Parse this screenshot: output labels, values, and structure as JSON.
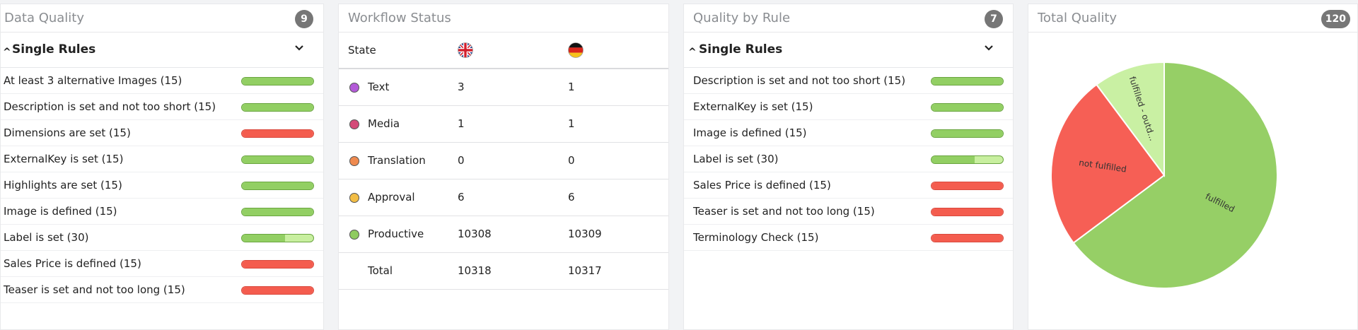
{
  "data_quality": {
    "title": "Data Quality",
    "count": "9",
    "group_title": "Single Rules",
    "rules": [
      {
        "label": "At least 3 alternative Images (15)",
        "fulfilled": 1.0,
        "status": "green"
      },
      {
        "label": "Description is set and not too short (15)",
        "fulfilled": 1.0,
        "status": "green"
      },
      {
        "label": "Dimensions are set (15)",
        "fulfilled": 0.0,
        "status": "red"
      },
      {
        "label": "ExternalKey is set (15)",
        "fulfilled": 1.0,
        "status": "green"
      },
      {
        "label": "Highlights are set (15)",
        "fulfilled": 1.0,
        "status": "green"
      },
      {
        "label": "Image is defined (15)",
        "fulfilled": 1.0,
        "status": "green"
      },
      {
        "label": "Label is set (30)",
        "fulfilled": 0.6,
        "status": "green"
      },
      {
        "label": "Sales Price is defined (15)",
        "fulfilled": 0.0,
        "status": "red"
      },
      {
        "label": "Teaser is set and not too long (15)",
        "fulfilled": 0.0,
        "status": "red"
      }
    ]
  },
  "workflow_status": {
    "title": "Workflow Status",
    "header": {
      "state": "State",
      "col_en_icon": "uk-flag-icon",
      "col_de_icon": "germany-flag-icon"
    },
    "rows": [
      {
        "state": "Text",
        "en": "3",
        "de": "1",
        "color": "#b35ad8"
      },
      {
        "state": "Media",
        "en": "1",
        "de": "1",
        "color": "#d44a78"
      },
      {
        "state": "Translation",
        "en": "0",
        "de": "0",
        "color": "#ef8a4f"
      },
      {
        "state": "Approval",
        "en": "6",
        "de": "6",
        "color": "#f2bd45"
      },
      {
        "state": "Productive",
        "en": "10308",
        "de": "10309",
        "color": "#8fcb60"
      }
    ],
    "total": {
      "state": "Total",
      "en": "10318",
      "de": "10317"
    }
  },
  "quality_by_rule": {
    "title": "Quality by Rule",
    "count": "7",
    "group_title": "Single Rules",
    "rules": [
      {
        "label": "Description is set and not too short (15)",
        "fulfilled": 1.0,
        "status": "green"
      },
      {
        "label": "ExternalKey is set (15)",
        "fulfilled": 1.0,
        "status": "green"
      },
      {
        "label": "Image is defined (15)",
        "fulfilled": 1.0,
        "status": "green"
      },
      {
        "label": "Label is set (30)",
        "fulfilled": 0.6,
        "status": "green"
      },
      {
        "label": "Sales Price is defined (15)",
        "fulfilled": 0.0,
        "status": "red"
      },
      {
        "label": "Teaser is set and not too long (15)",
        "fulfilled": 0.0,
        "status": "red"
      },
      {
        "label": "Terminology Check (15)",
        "fulfilled": 0.0,
        "status": "red"
      }
    ]
  },
  "total_quality": {
    "title": "Total Quality",
    "count": "120",
    "chart_data": {
      "type": "pie",
      "slices": [
        {
          "label": "fulfilled",
          "value": 0.648,
          "color": "#96cf66"
        },
        {
          "label": "not fulfilled",
          "value": 0.25,
          "color": "#f65f55"
        },
        {
          "label": "fulfilled - outd...",
          "value": 0.102,
          "color": "#c9f0a3"
        }
      ]
    }
  }
}
